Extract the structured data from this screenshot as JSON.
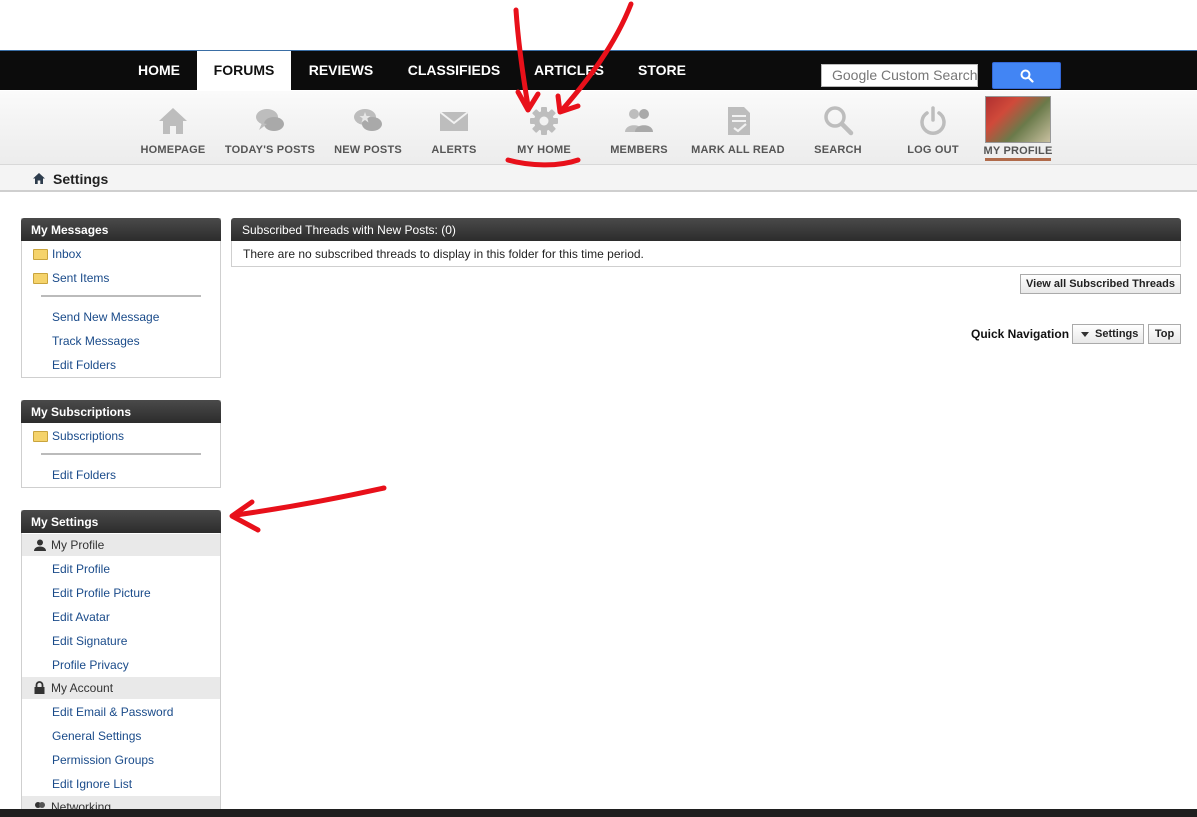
{
  "top_nav": {
    "tabs": [
      {
        "label": "HOME"
      },
      {
        "label": "FORUMS"
      },
      {
        "label": "REVIEWS"
      },
      {
        "label": "CLASSIFIEDS"
      },
      {
        "label": "ARTICLES"
      },
      {
        "label": "STORE"
      }
    ],
    "active_tab": "FORUMS",
    "search_placeholder": "Google Custom Search",
    "search_button_icon": "search-icon"
  },
  "sub_nav": {
    "items": [
      {
        "label": "HOMEPAGE",
        "icon": "house-icon"
      },
      {
        "label": "TODAY'S POSTS",
        "icon": "speech-bubbles-icon"
      },
      {
        "label": "NEW POSTS",
        "icon": "speech-bubbles-star-icon"
      },
      {
        "label": "ALERTS",
        "icon": "envelope-icon"
      },
      {
        "label": "MY HOME",
        "icon": "gear-icon"
      },
      {
        "label": "MEMBERS",
        "icon": "members-icon"
      },
      {
        "label": "MARK ALL READ",
        "icon": "document-check-icon"
      },
      {
        "label": "SEARCH",
        "icon": "magnifier-icon"
      },
      {
        "label": "LOG OUT",
        "icon": "power-icon"
      },
      {
        "label": "MY PROFILE",
        "icon": "profile-thumbnail"
      }
    ]
  },
  "breadcrumb": {
    "current": "Settings"
  },
  "sidebar": {
    "messages": {
      "title": "My Messages",
      "folders": [
        "Inbox",
        "Sent Items"
      ],
      "links": [
        "Send New Message",
        "Track Messages",
        "Edit Folders"
      ]
    },
    "subscriptions": {
      "title": "My Subscriptions",
      "folders": [
        "Subscriptions"
      ],
      "links": [
        "Edit Folders"
      ]
    },
    "settings": {
      "title": "My Settings",
      "profile_group": "My Profile",
      "profile_links": [
        "Edit Profile",
        "Edit Profile Picture",
        "Edit Avatar",
        "Edit Signature",
        "Profile Privacy"
      ],
      "account_group": "My Account",
      "account_links": [
        "Edit Email & Password",
        "General Settings",
        "Permission Groups",
        "Edit Ignore List"
      ],
      "networking_group": "Networking"
    }
  },
  "main": {
    "header": "Subscribed Threads with New Posts: (0)",
    "empty_message": "There are no subscribed threads to display in this folder for this time period.",
    "view_all_button": "View all Subscribed Threads",
    "quick_nav_label": "Quick Navigation",
    "quick_nav_select": "Settings",
    "top_button": "Top"
  },
  "colors": {
    "annotation_red": "#e8101a",
    "link_blue": "#1a4b8a",
    "search_blue": "#4285f4",
    "header_dark": "#2c2c2c"
  }
}
